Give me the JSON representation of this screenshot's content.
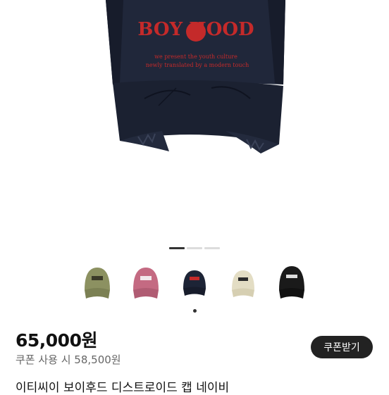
{
  "gallery": {
    "pager_count": 3,
    "active_index": 0
  },
  "hero_cap": {
    "logo_text": "BOY HOOD",
    "front_lines": [
      "we present the youth culture",
      "newly translated by a modern touch"
    ]
  },
  "thumbnails": [
    {
      "color": "olive",
      "hex": "#8c9161"
    },
    {
      "color": "pink",
      "hex": "#c46a82"
    },
    {
      "color": "navy",
      "hex": "#1d2436"
    },
    {
      "color": "beige",
      "hex": "#e3ddc4"
    },
    {
      "color": "black",
      "hex": "#1a1a1a"
    }
  ],
  "product": {
    "price": "65,000원",
    "coupon_info": "쿠폰 사용 시 58,500원",
    "coupon_button": "쿠폰받기",
    "title": "이티씨이 보이후드 디스트로이드 캡 네이비"
  }
}
